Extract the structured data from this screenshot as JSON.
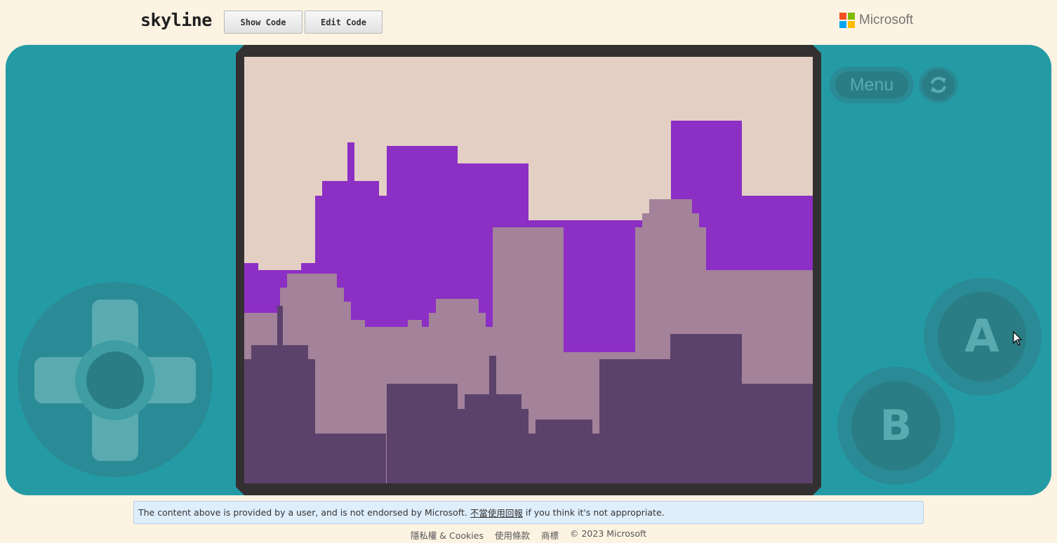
{
  "header": {
    "title": "skyline",
    "show_code_label": "Show Code",
    "edit_code_label": "Edit Code",
    "brand_name": "Microsoft",
    "brand_colors": [
      "#f25022",
      "#7fba00",
      "#00a4ef",
      "#ffb900"
    ]
  },
  "console": {
    "body_color": "#249ba4",
    "frame_color": "#333031",
    "menu_label": "Menu",
    "a_label": "A",
    "b_label": "B",
    "refresh_icon": "refresh-icon",
    "dpad_icon": "dpad-icon"
  },
  "game": {
    "scene": "pixel city skyline",
    "palette": {
      "sky": "#e3cfc4",
      "far_buildings": "#8c2fc4",
      "mid_buildings": "#a3829a",
      "near_buildings": "#5b426b"
    }
  },
  "notice": {
    "text_before": "The content above is provided by a user, and is not endorsed by Microsoft.",
    "link_text": "不當使用回報",
    "text_after": "if you think it's not appropriate."
  },
  "footer": {
    "links": [
      "隱私權 & Cookies",
      "使用條款",
      "商標"
    ],
    "copyright": "© 2023 Microsoft"
  }
}
